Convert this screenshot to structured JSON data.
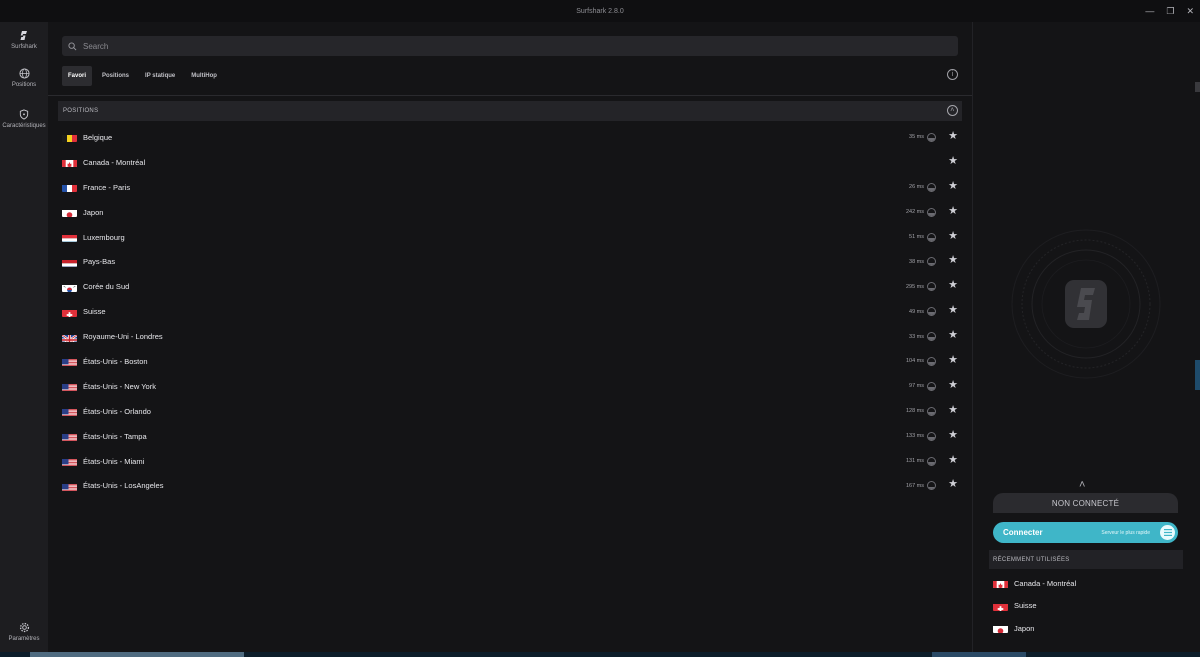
{
  "window": {
    "title": "Surfshark 2.8.0"
  },
  "sidebar": {
    "items": [
      {
        "label": "Surfshark",
        "icon": "surfshark-logo-icon"
      },
      {
        "label": "Positions",
        "icon": "globe-icon"
      },
      {
        "label": "Caractéristiques",
        "icon": "shield-icon"
      }
    ],
    "settings_label": "Paramètres"
  },
  "search": {
    "placeholder": "Search"
  },
  "tabs": [
    "Favori",
    "Positions",
    "IP statique",
    "MultiHop"
  ],
  "active_tab": "Favori",
  "section": {
    "title": "POSITIONS"
  },
  "locations": [
    {
      "name": "Belgique",
      "ping": "35 ms",
      "flag": "be"
    },
    {
      "name": "Canada - Montréal",
      "ping": "",
      "flag": "ca"
    },
    {
      "name": "France - Paris",
      "ping": "26 ms",
      "flag": "fr"
    },
    {
      "name": "Japon",
      "ping": "242 ms",
      "flag": "jp"
    },
    {
      "name": "Luxembourg",
      "ping": "51 ms",
      "flag": "lu"
    },
    {
      "name": "Pays-Bas",
      "ping": "38 ms",
      "flag": "nl"
    },
    {
      "name": "Corée du Sud",
      "ping": "295 ms",
      "flag": "kr"
    },
    {
      "name": "Suisse",
      "ping": "49 ms",
      "flag": "ch"
    },
    {
      "name": "Royaume-Uni - Londres",
      "ping": "33 ms",
      "flag": "gb"
    },
    {
      "name": "États-Unis - Boston",
      "ping": "104 ms",
      "flag": "us"
    },
    {
      "name": "États-Unis - New York",
      "ping": "97 ms",
      "flag": "us"
    },
    {
      "name": "États-Unis - Orlando",
      "ping": "128 ms",
      "flag": "us"
    },
    {
      "name": "États-Unis - Tampa",
      "ping": "133 ms",
      "flag": "us"
    },
    {
      "name": "États-Unis - Miami",
      "ping": "131 ms",
      "flag": "us"
    },
    {
      "name": "États-Unis - LosAngeles",
      "ping": "167 ms",
      "flag": "us"
    }
  ],
  "connection": {
    "status": "NON CONNECTÉ",
    "connect_label": "Connecter",
    "server_label": "Serveur le plus rapide"
  },
  "recent": {
    "title": "RÉCEMMENT UTILISÉES",
    "items": [
      {
        "name": "Canada - Montréal",
        "flag": "ca"
      },
      {
        "name": "Suisse",
        "flag": "ch"
      },
      {
        "name": "Japon",
        "flag": "jp"
      }
    ]
  },
  "colors": {
    "accent": "#3fb6c8",
    "background": "#141416",
    "sidebar": "#1d1d20"
  }
}
